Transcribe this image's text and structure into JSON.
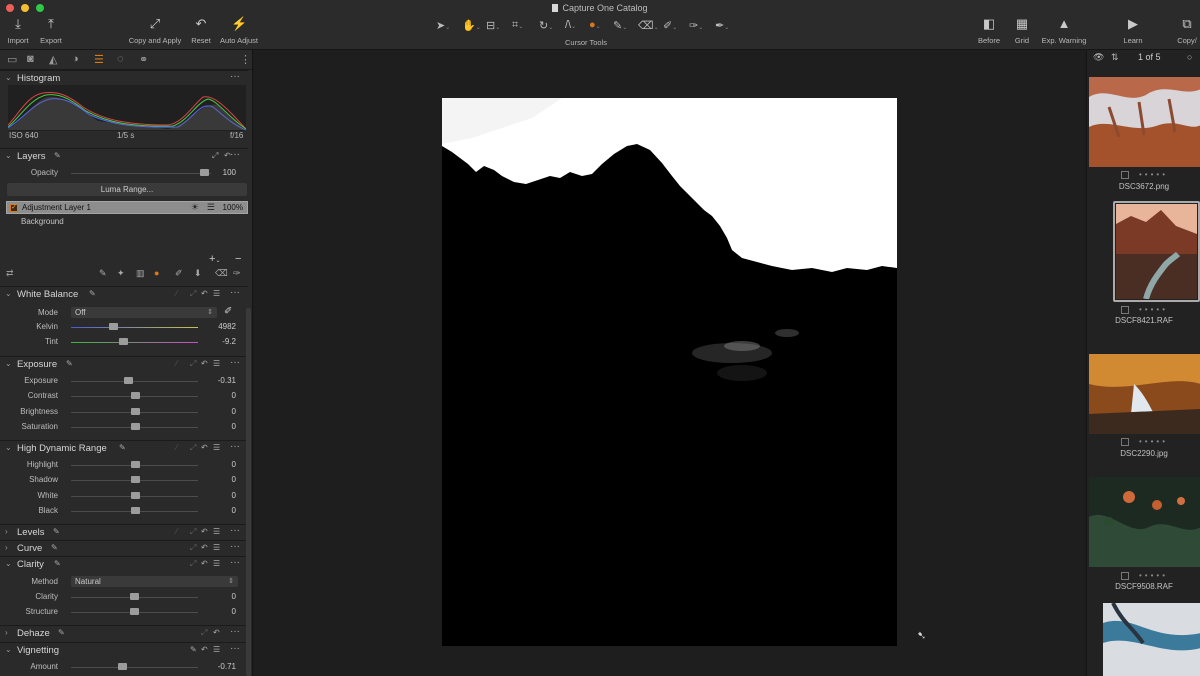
{
  "window": {
    "title": "Capture One Catalog"
  },
  "toolbar": {
    "import": "Import",
    "export": "Export",
    "copy_apply": "Copy and Apply",
    "reset": "Reset",
    "auto_adjust": "Auto Adjust",
    "cursor_tools": "Cursor Tools",
    "before": "Before",
    "grid": "Grid",
    "exp_warning": "Exp. Warning",
    "learn": "Learn",
    "copy": "Copy/"
  },
  "histogram": {
    "title": "Histogram",
    "iso": "ISO 640",
    "shutter": "1/5 s",
    "aperture": "f/16"
  },
  "layers": {
    "title": "Layers",
    "opacity_label": "Opacity",
    "opacity_value": "100",
    "opacity_level": 0.95,
    "luma_button": "Luma Range...",
    "layer1_name": "Adjustment Layer 1",
    "layer1_opacity": "100%",
    "background": "Background"
  },
  "white_balance": {
    "title": "White Balance",
    "mode_label": "Mode",
    "mode_value": "Off",
    "kelvin_label": "Kelvin",
    "kelvin_value": "4982",
    "tint_label": "Tint",
    "tint_value": "-9.2"
  },
  "exposure": {
    "title": "Exposure",
    "rows": [
      {
        "label": "Exposure",
        "value": "-0.31",
        "pos": 0.45
      },
      {
        "label": "Contrast",
        "value": "0",
        "pos": 0.5
      },
      {
        "label": "Brightness",
        "value": "0",
        "pos": 0.5
      },
      {
        "label": "Saturation",
        "value": "0",
        "pos": 0.5
      }
    ]
  },
  "hdr": {
    "title": "High Dynamic Range",
    "rows": [
      {
        "label": "Highlight",
        "value": "0",
        "pos": 0.5
      },
      {
        "label": "Shadow",
        "value": "0",
        "pos": 0.5
      },
      {
        "label": "White",
        "value": "0",
        "pos": 0.5
      },
      {
        "label": "Black",
        "value": "0",
        "pos": 0.5
      }
    ]
  },
  "levels": {
    "title": "Levels"
  },
  "curve": {
    "title": "Curve"
  },
  "clarity": {
    "title": "Clarity",
    "method_label": "Method",
    "method_value": "Natural",
    "clarity_label": "Clarity",
    "clarity_value": "0",
    "structure_label": "Structure",
    "structure_value": "0"
  },
  "dehaze": {
    "title": "Dehaze"
  },
  "vignetting": {
    "title": "Vignetting",
    "amount_label": "Amount",
    "amount_value": "-0.71",
    "amount_pos": 0.4
  },
  "browser": {
    "counter": "1 of 5",
    "files": [
      "DSC3672.png",
      "DSCF8421.RAF",
      "DSC2290.jpg",
      "DSCF9508.RAF"
    ]
  },
  "colors": {
    "accent": "#d87a18",
    "panel": "#2a2a2a",
    "viewer": "#1e1e1e"
  }
}
